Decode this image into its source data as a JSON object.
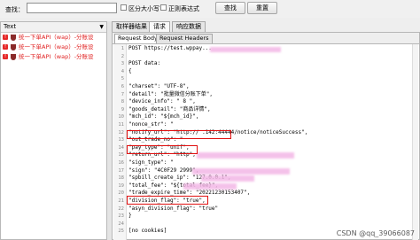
{
  "search": {
    "label": "查找：",
    "case_label": "区分大小写",
    "regex_label": "正则表达式",
    "find_button": "查找",
    "reset_button": "重置"
  },
  "left": {
    "view_select": "Text",
    "items": [
      {
        "label": "统一下单API（wap）-分账设",
        "status": "error"
      },
      {
        "label": "统一下单API（wap）-分账设",
        "status": "error"
      },
      {
        "label": "统一下单API（wap）-分账设",
        "status": "ok"
      }
    ]
  },
  "tabs": {
    "main": [
      "取样器结果",
      "请求",
      "响应数据"
    ],
    "sub": [
      "Request Body",
      "Request Headers"
    ]
  },
  "code": {
    "lines": [
      {
        "n": "1",
        "t": "POST https://test.wppay..."
      },
      {
        "n": "2",
        "t": ""
      },
      {
        "n": "3",
        "t": "POST data:"
      },
      {
        "n": "4",
        "t": "{"
      },
      {
        "n": "5",
        "t": ""
      },
      {
        "n": "6",
        "t": "  \"charset\": \"UTF-8\","
      },
      {
        "n": "7",
        "t": "  \"detail\": \"批量微信分账下单\","
      },
      {
        "n": "8",
        "t": "  \"device_info\": \" 8    \","
      },
      {
        "n": "9",
        "t": "  \"goods_detail\": \"商品详情\","
      },
      {
        "n": "10",
        "t": "  \"mch_id\": \"${mch_id}\","
      },
      {
        "n": "11",
        "t": "  \"nonce_str\": \""
      },
      {
        "n": "12",
        "t": "  \"notify_url\": \"http://        .142:44444/notice/noticeSuccess\","
      },
      {
        "n": "13",
        "t": "  \"out_trade_no\": \""
      },
      {
        "n": "14",
        "t": "  \"pay_type\": \"unif\","
      },
      {
        "n": "15",
        "t": "  \"return_url\": \"http\","
      },
      {
        "n": "16",
        "t": "  \"sign_type\": \""
      },
      {
        "n": "17",
        "t": "  \"sign\": \"4C0F29      2999\","
      },
      {
        "n": "18",
        "t": "  \"spbill_create_ip\": \"127.0.0.1\","
      },
      {
        "n": "19",
        "t": "  \"total_fee\": \"${total_fee}\","
      },
      {
        "n": "20",
        "t": "  \"trade_expire_time\": \"20221230153407\","
      },
      {
        "n": "21",
        "t": "  \"division_flag\": \"true\","
      },
      {
        "n": "22",
        "t": "  \"asyn_division_flag\": \"true\""
      },
      {
        "n": "23",
        "t": "}"
      },
      {
        "n": "24",
        "t": ""
      },
      {
        "n": "25",
        "t": "[no cookies]"
      }
    ]
  },
  "watermark": "CSDN @qq_39066087",
  "colors": {
    "highlight": "#e01010",
    "error": "#e52828",
    "ok": "#2c9b2c"
  }
}
